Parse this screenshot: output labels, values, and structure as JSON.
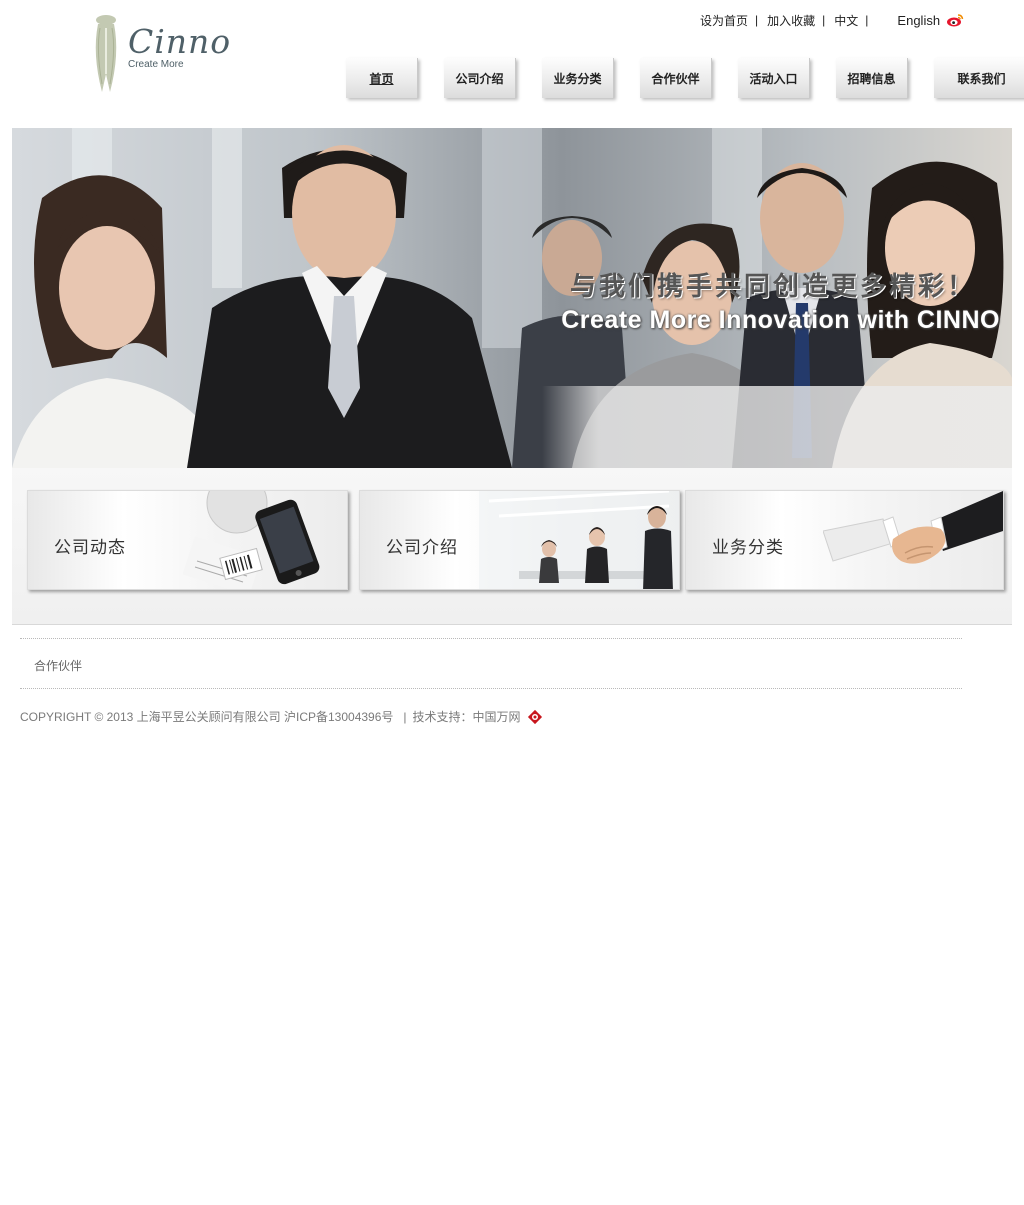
{
  "header": {
    "logo": {
      "name": "Cinno",
      "tagline": "Create More"
    },
    "toplinks": {
      "set_home": "设为首页",
      "favorite": "加入收藏",
      "chinese": "中文",
      "english": "English",
      "separator": "|"
    },
    "nav": [
      {
        "label": "首页",
        "active": true
      },
      {
        "label": "公司介绍"
      },
      {
        "label": "业务分类"
      },
      {
        "label": "合作伙伴"
      },
      {
        "label": "活动入口"
      },
      {
        "label": "招聘信息"
      },
      {
        "label": "联系我们"
      }
    ]
  },
  "banner": {
    "headline_cn": "与我们携手共同创造更多精彩！",
    "headline_en": "Create More Innovation with CINNO"
  },
  "features": [
    {
      "label": "公司动态",
      "icon": "phone-documents-image"
    },
    {
      "label": "公司介绍",
      "icon": "office-meeting-image"
    },
    {
      "label": "业务分类",
      "icon": "handshake-image"
    }
  ],
  "partners": {
    "label": "合作伙伴"
  },
  "footer": {
    "copyright": "COPYRIGHT © 2013 上海平昱公关顾问有限公司 沪ICP备13004396号",
    "separator": "|",
    "tech_support": "技术支持：中国万网"
  },
  "colors": {
    "logo": "#4f6068",
    "logo_mark": "#c3c9b2",
    "footer_text": "#7a7a7a",
    "weibo_red": "#e6162d"
  }
}
